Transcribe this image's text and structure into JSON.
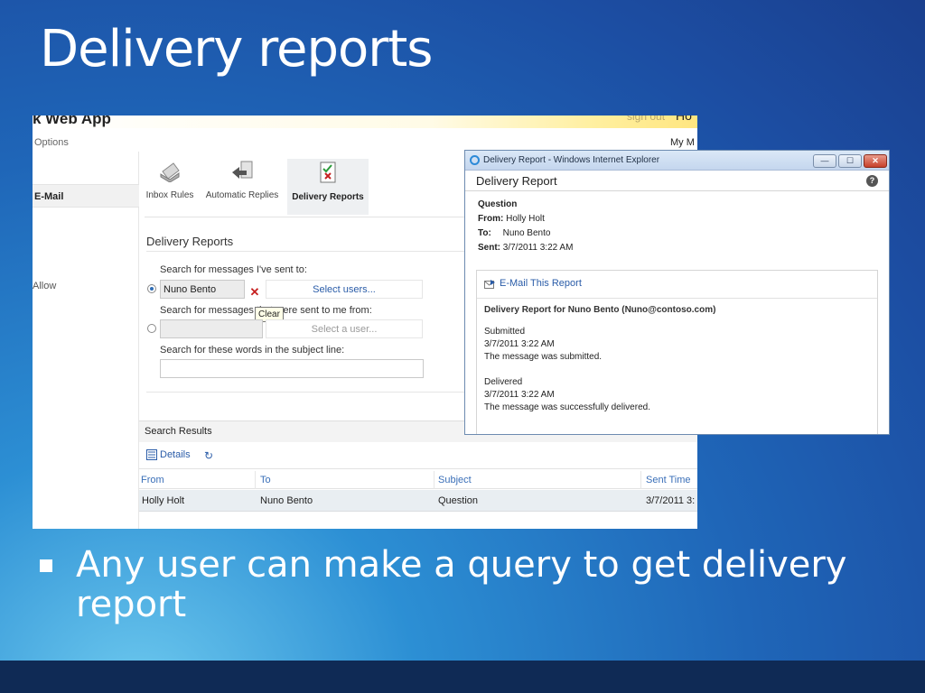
{
  "slide": {
    "title": "Delivery reports",
    "bullet": "Any user can make a query to get delivery report"
  },
  "owa": {
    "brand": "k Web App",
    "signout": "sign out",
    "user_truncated": "Ho",
    "options": "Options",
    "my_mail": "My M",
    "nav": {
      "email": "E-Mail",
      "allow": "Allow"
    },
    "toolbar": {
      "inbox_rules": "Inbox Rules",
      "automatic_replies": "Automatic Replies",
      "delivery_reports": "Delivery Reports"
    },
    "form": {
      "section_title": "Delivery Reports",
      "sent_to_label": "Search for messages I've sent to:",
      "sent_to_value": "Nuno Bento",
      "select_users": "Select users...",
      "sent_from_label": "Search for messages that were sent to me from:",
      "select_a_user": "Select a user...",
      "subject_label": "Search for these words in the subject line:",
      "subject_value": "",
      "clear_tooltip": "Clear"
    },
    "results": {
      "title": "Search Results",
      "details_label": "Details",
      "columns": [
        "From",
        "To",
        "Subject",
        "Sent Time"
      ],
      "rows": [
        {
          "from": "Holly Holt",
          "to": "Nuno Bento",
          "subject": "Question",
          "sent": "3/7/2011 3:"
        }
      ]
    }
  },
  "popup": {
    "window_title": "Delivery Report - Windows Internet Explorer",
    "header": "Delivery Report",
    "subject": "Question",
    "from_label": "From:",
    "from_value": "Holly Holt",
    "to_label": "To:",
    "to_value": "Nuno Bento",
    "sent_label": "Sent:",
    "sent_value": "3/7/2011 3:22 AM",
    "email_report": "E-Mail This Report",
    "report_for": "Delivery Report for  Nuno Bento (Nuno@contoso.com)",
    "events": [
      {
        "status": "Submitted",
        "time": "3/7/2011 3:22 AM",
        "detail": "The message was submitted."
      },
      {
        "status": "Delivered",
        "time": "3/7/2011 3:22 AM",
        "detail": "The message was successfully delivered."
      }
    ]
  }
}
